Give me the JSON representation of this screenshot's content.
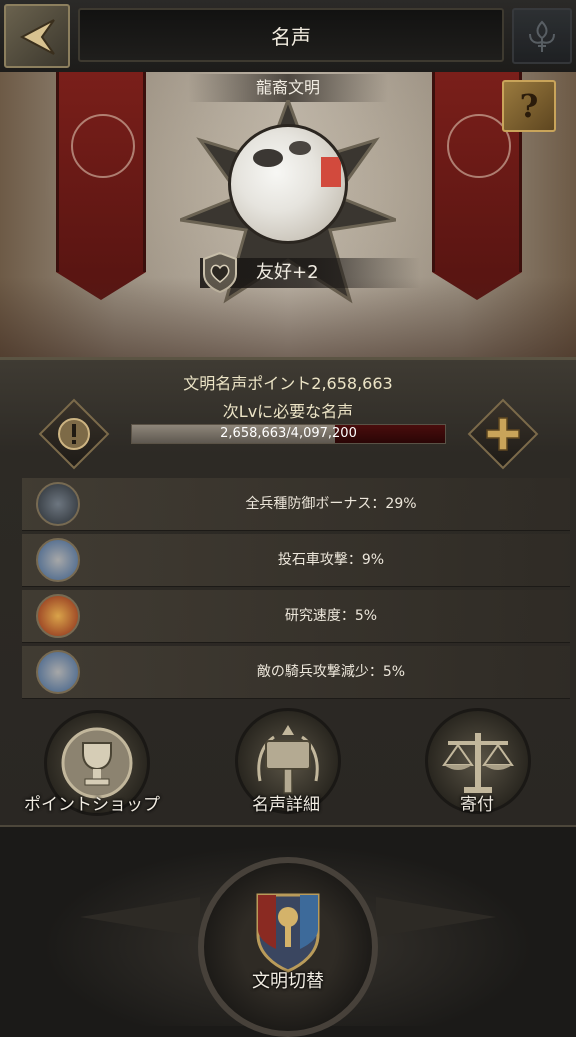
{
  "header": {
    "title": "名声",
    "back_icon": "chevron-left-icon",
    "menu_icon": "fleur-icon"
  },
  "hero": {
    "civ_name": "龍裔文明",
    "help_label": "?",
    "friendship": "友好+2"
  },
  "points": {
    "line1": "文明名声ポイント2,658,663",
    "line2": "次Lvに必要な名声",
    "progress_text": "2,658,663/4,097,200",
    "progress_fraction": 0.649
  },
  "bonuses": [
    {
      "text": "全兵種防御ボーナス：29%",
      "icon": "shield-cross-icon"
    },
    {
      "text": "投石車攻撃：9%",
      "icon": "soldier-icon"
    },
    {
      "text": "研究速度：5%",
      "icon": "research-icon"
    },
    {
      "text": "敵の騎兵攻撃減少：5%",
      "icon": "soldier-icon"
    }
  ],
  "actions": {
    "shop": "ポイントショップ",
    "detail": "名声詳細",
    "donate": "寄付"
  },
  "footer": {
    "switch_label": "文明切替"
  },
  "colors": {
    "gold": "#c9a45a",
    "banner_red": "#7a1f1a",
    "panel": "#2d2a25"
  }
}
